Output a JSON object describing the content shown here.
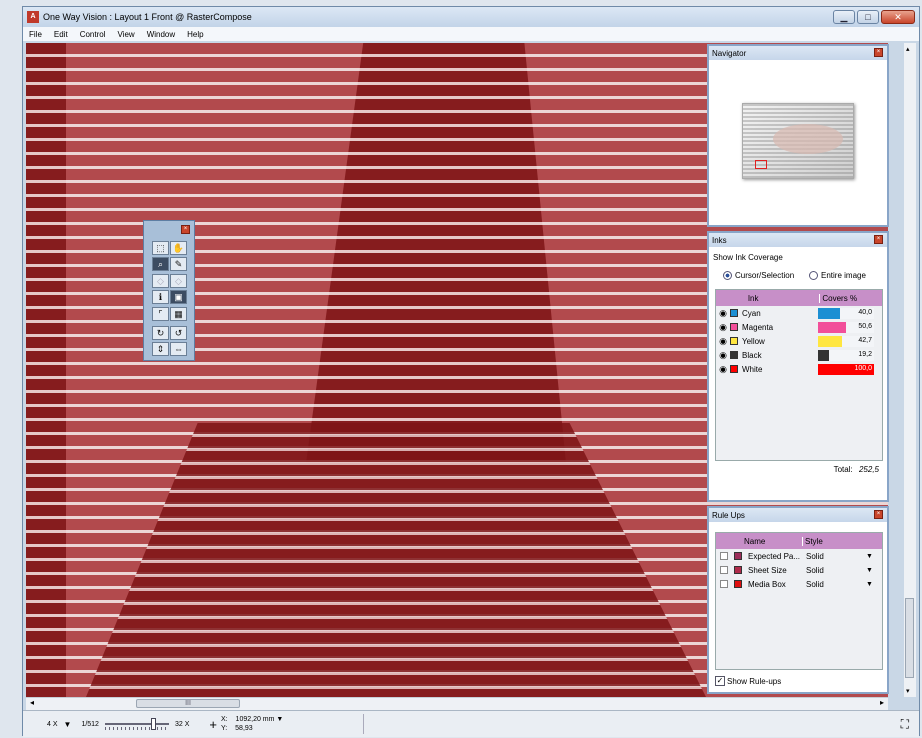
{
  "window": {
    "title": "One Way Vision : Layout 1 Front @ RasterCompose",
    "app_icon": "A"
  },
  "menu": [
    "File",
    "Edit",
    "Control",
    "View",
    "Window",
    "Help"
  ],
  "navigator": {
    "title": "Navigator"
  },
  "inks": {
    "title": "Inks",
    "show_label": "Show Ink Coverage",
    "options": [
      "Cursor/Selection",
      "Entire image"
    ],
    "col_ink": "Ink",
    "col_cover": "Covers %",
    "rows": [
      {
        "name": "Cyan",
        "value": "40,0",
        "pct": 0.4,
        "color": "#1b8fd3"
      },
      {
        "name": "Magenta",
        "value": "50,6",
        "pct": 0.506,
        "color": "#f24f9a"
      },
      {
        "name": "Yellow",
        "value": "42,7",
        "pct": 0.427,
        "color": "#ffe640"
      },
      {
        "name": "Black",
        "value": "19,2",
        "pct": 0.192,
        "color": "#333333"
      },
      {
        "name": "White",
        "value": "100,0",
        "pct": 1.0,
        "color": "#ff0000"
      }
    ],
    "total_label": "Total:",
    "total_value": "252,5"
  },
  "ruleups": {
    "title": "Rule Ups",
    "col_name": "Name",
    "col_style": "Style",
    "rows": [
      {
        "name": "Expected Pa...",
        "style": "Solid",
        "color": "#9b2d5a"
      },
      {
        "name": "Sheet Size",
        "style": "Solid",
        "color": "#b02a4a"
      },
      {
        "name": "Media Box",
        "style": "Solid",
        "color": "#e01010"
      }
    ],
    "show_label": "Show Rule-ups"
  },
  "status": {
    "zoom": "4 X",
    "zoom_min": "1/512",
    "zoom_max": "32 X",
    "x_label": "X:",
    "x_value": "1092,20 mm",
    "y_label": "Y:",
    "y_value": "58,93"
  },
  "scroll": {
    "grip": "III"
  }
}
